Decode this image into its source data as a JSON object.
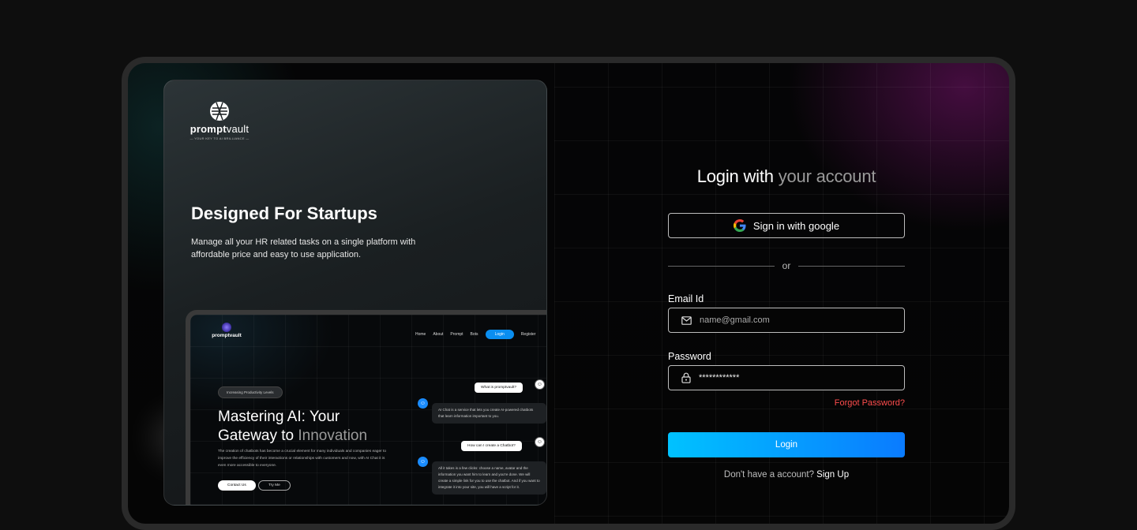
{
  "brand": {
    "name_bold": "prompt",
    "name_regular": "vault",
    "tagline": "— YOUR KEY TO AI BRILLIANCE —"
  },
  "hero": {
    "title": "Designed For Startups",
    "text": "Manage all your HR related tasks on a single platform with affordable price and easy to use application."
  },
  "preview": {
    "logo": "promptvault",
    "nav": [
      "Home",
      "About",
      "Prompt",
      "Bots"
    ],
    "login": "Login",
    "register": "Register",
    "pill": "Increasing Productivity Levels",
    "title_a": "Mastering AI: Your",
    "title_b": "Gateway to ",
    "title_c": "Innovation",
    "text": "The creation of chatbots has become a crucial element for many individuals and companies eager to improve the efficiency of their interactions or relationships with customers and now, with AI Chat it is even more accessible to everyone.",
    "contact": "Contact Us",
    "try": "Try Me",
    "q1": "What is promptvault?",
    "a1": "AI Chat is a service that lets you create AI-powered chatbots that learn information important to you.",
    "q2": "How can I create a Chatbot?",
    "a2": "All it takes is a few clicks: choose a name, avatar and the information you want him to learn and you're done. We will create a simple link for you to use the chatbot. And if you want to integrate it into your site, you will have a script for it."
  },
  "login": {
    "title_a": "Login with ",
    "title_b": "your account",
    "google_label": "Sign in with google",
    "or": "or",
    "email_label": "Email Id",
    "email_placeholder": "name@gmail.com",
    "password_label": "Password",
    "password_value": "************",
    "forgot": "Forgot Password?",
    "button": "Login",
    "signup_text": "Don't have a account? ",
    "signup_link": "Sign Up"
  },
  "colors": {
    "accent_start": "#00c2ff",
    "accent_end": "#0a7bff",
    "forgot": "#ff4d4d"
  }
}
